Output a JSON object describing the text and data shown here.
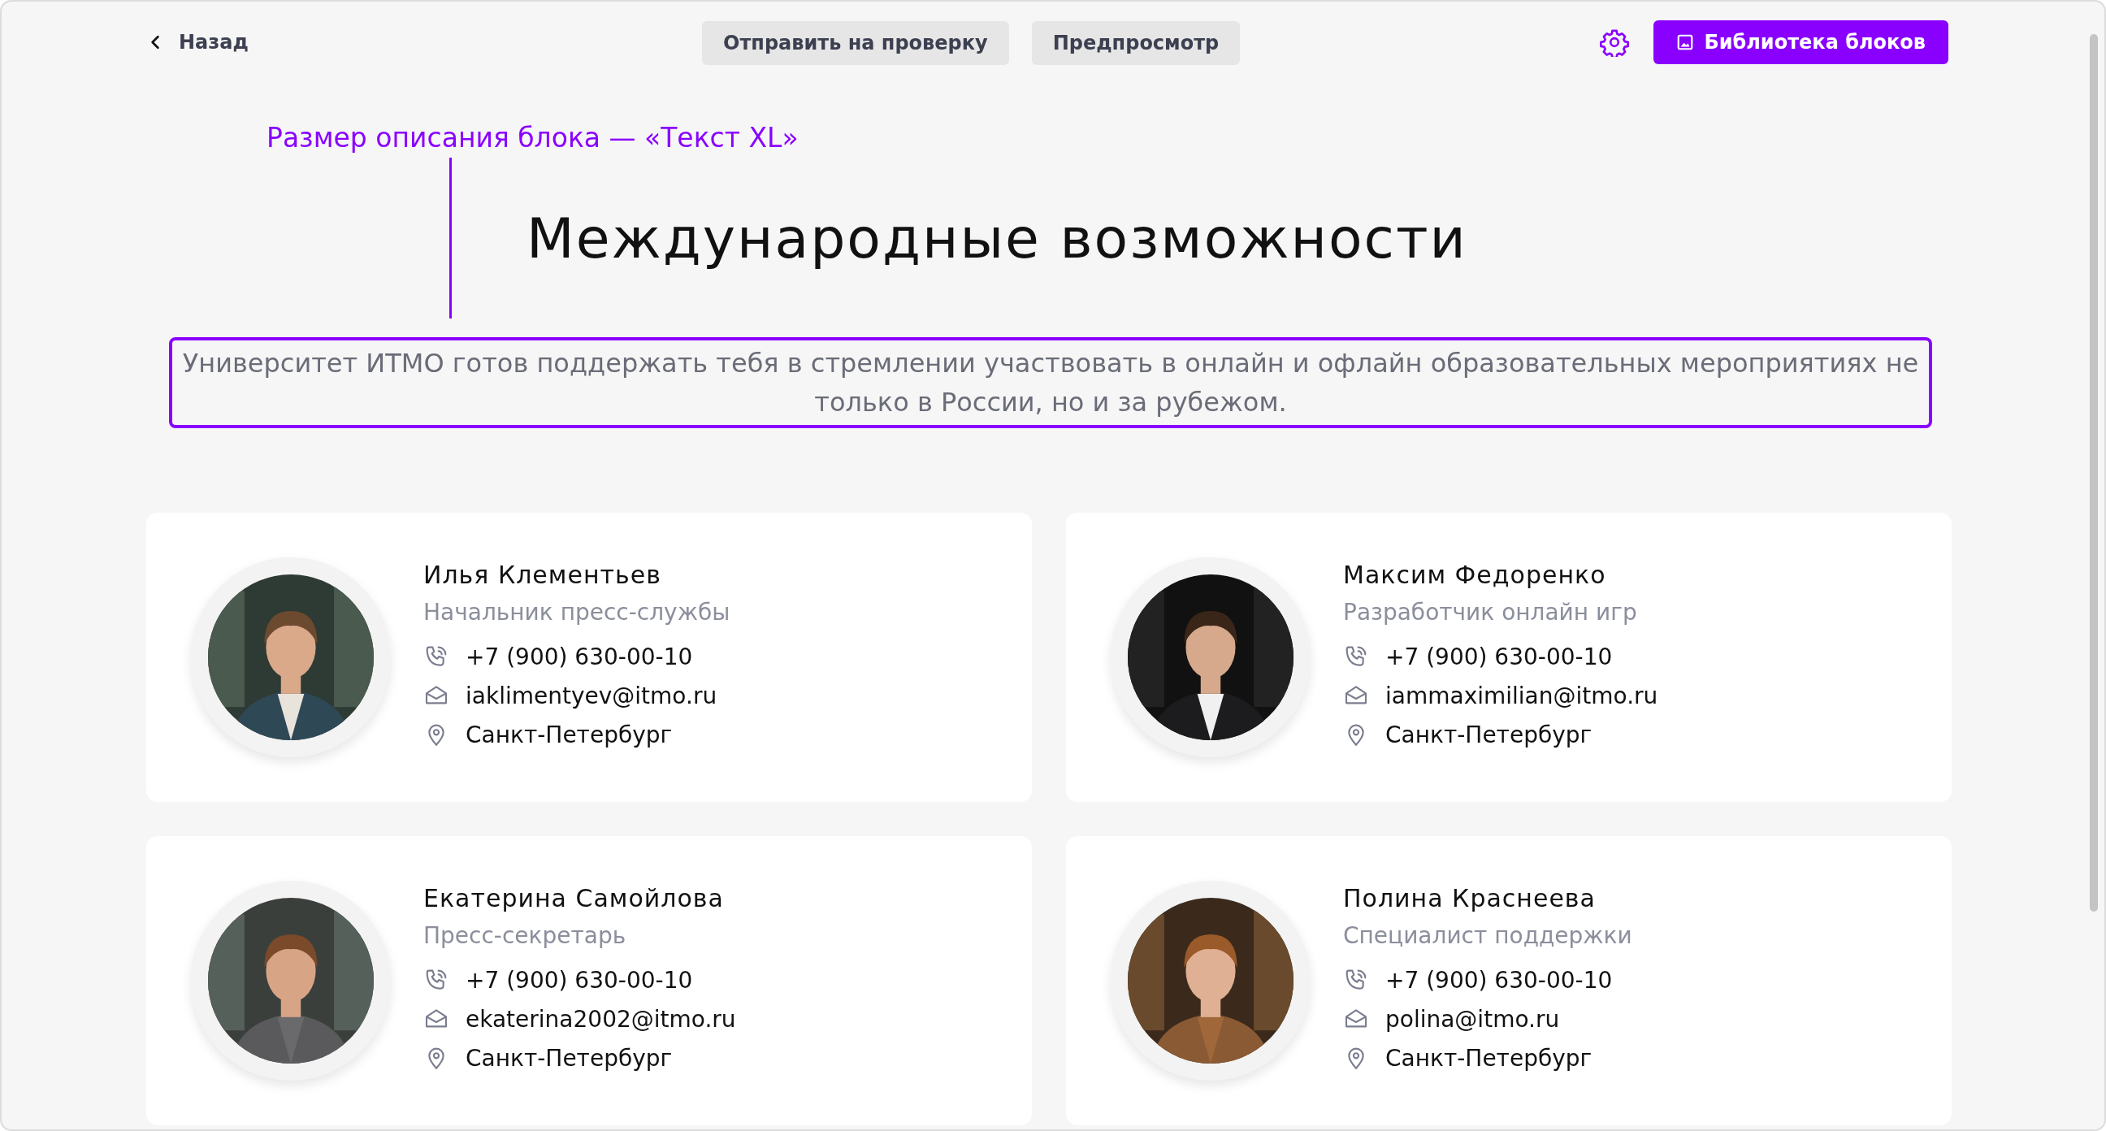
{
  "toolbar": {
    "back": "Назад",
    "buttons": [
      "Отправить на проверку",
      "Предпросмотр"
    ],
    "library_button": "Библиотека блоков"
  },
  "annotation": "Размер описания блока — «Текст XL»",
  "heading": "Международные возможности",
  "description": "Университет ИТМО готов поддержать тебя в стремлении участвовать в онлайн и офлайн образовательных мероприятиях не только в России, но и за рубежом.",
  "contacts": [
    {
      "name": "Илья Клементьев",
      "role": "Начальник пресс-службы",
      "phone": "+7 (900) 630-00-10",
      "email": "iaklimentyev@itmo.ru",
      "city": "Санкт-Петербург"
    },
    {
      "name": "Максим Федоренко",
      "role": "Разработчик онлайн игр",
      "phone": "+7 (900) 630-00-10",
      "email": "iammaximilian@itmo.ru",
      "city": "Санкт-Петербург"
    },
    {
      "name": "Екатерина Самойлова",
      "role": "Пресс-секретарь",
      "phone": "+7 (900) 630-00-10",
      "email": "ekaterina2002@itmo.ru",
      "city": "Санкт-Петербург"
    },
    {
      "name": "Полина Краснеева",
      "role": "Специалист поддержки",
      "phone": "+7 (900) 630-00-10",
      "email": "polina@itmo.ru",
      "city": "Санкт-Петербург"
    }
  ]
}
